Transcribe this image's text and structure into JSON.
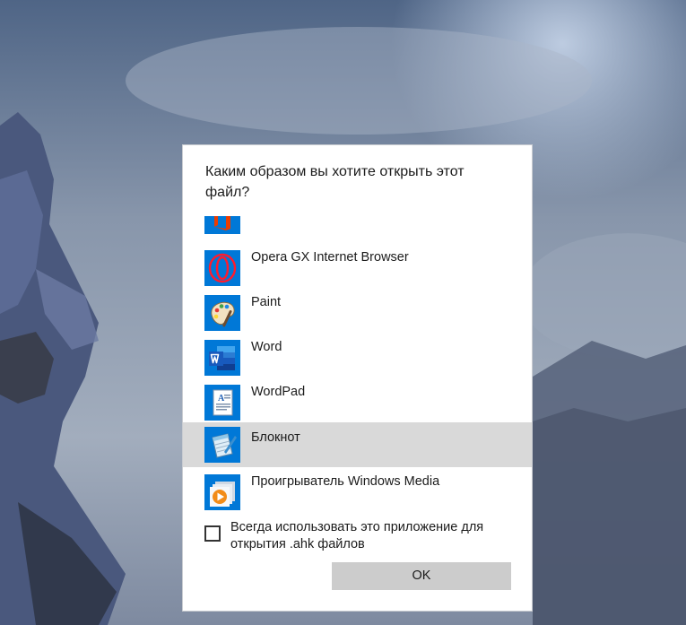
{
  "dialog": {
    "title": "Каким образом вы хотите открыть этот файл?",
    "apps": [
      {
        "label": "",
        "icon": "office-icon"
      },
      {
        "label": "Opera GX Internet Browser",
        "icon": "opera-gx-icon"
      },
      {
        "label": "Paint",
        "icon": "paint-palette-icon"
      },
      {
        "label": "Word",
        "icon": "word-icon"
      },
      {
        "label": "WordPad",
        "icon": "wordpad-icon"
      },
      {
        "label": "Блокнот",
        "icon": "notepad-icon",
        "selected": true
      },
      {
        "label": "Проигрыватель Windows Media",
        "icon": "windows-media-player-icon"
      }
    ],
    "always_use_label": "Всегда использовать это приложение для открытия .ahk файлов",
    "always_use_checked": false,
    "ok_label": "OK"
  },
  "colors": {
    "accent": "#0078d7",
    "selected_row": "#d9d9d9",
    "button": "#cccccc"
  }
}
